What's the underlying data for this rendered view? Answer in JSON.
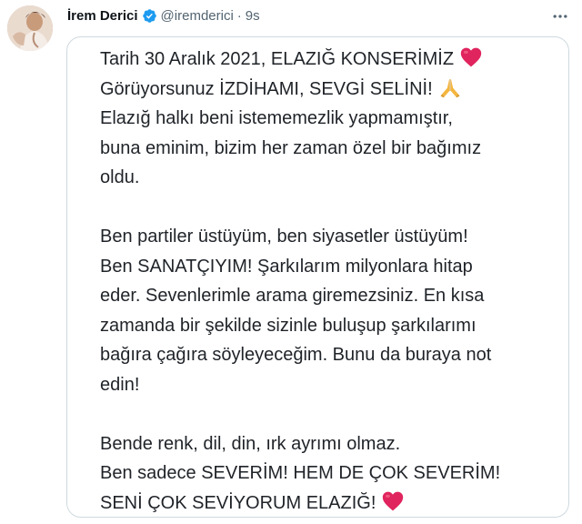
{
  "tweet": {
    "display_name": "İrem Derici",
    "handle": "@iremderici",
    "separator": "·",
    "time": "9s",
    "verified_icon": "verified-badge-icon",
    "more_icon": "more-options-icon",
    "accent_color": "#1d9bf0",
    "secondary_text_color": "#536471"
  },
  "card": {
    "paragraphs": [
      {
        "lines": [
          "Tarih 30 Aralık 2021, ELAZIĞ KONSERİMİZ",
          "Görüyorsunuz İZDİHAMI, SEVGİ SELİNİ!",
          "Elazığ halkı beni istememezlik yapmamıştır,",
          "buna eminim, bizim her zaman özel bir bağımız",
          "oldu."
        ]
      },
      {
        "lines": [
          "Ben partiler üstüyüm, ben siyasetler üstüyüm!",
          "Ben SANATÇIYIM! Şarkılarım milyonlara hitap",
          "eder. Sevenlerimle arama giremezsiniz. En kısa",
          "zamanda bir şekilde sizinle buluşup şarkılarımı",
          "bağıra çağıra söyleyeceğim. Bunu da buraya not",
          "edin!"
        ]
      },
      {
        "lines": [
          "Bende renk, dil, din, ırk ayrımı olmaz.",
          "Ben sadece SEVERİM! HEM DE ÇOK SEVERİM!",
          "SENİ ÇOK SEVİYORUM ELAZIĞ!"
        ]
      }
    ],
    "emojis": {
      "heart": "red-heart-icon",
      "praying_hands": "folded-hands-icon"
    }
  }
}
